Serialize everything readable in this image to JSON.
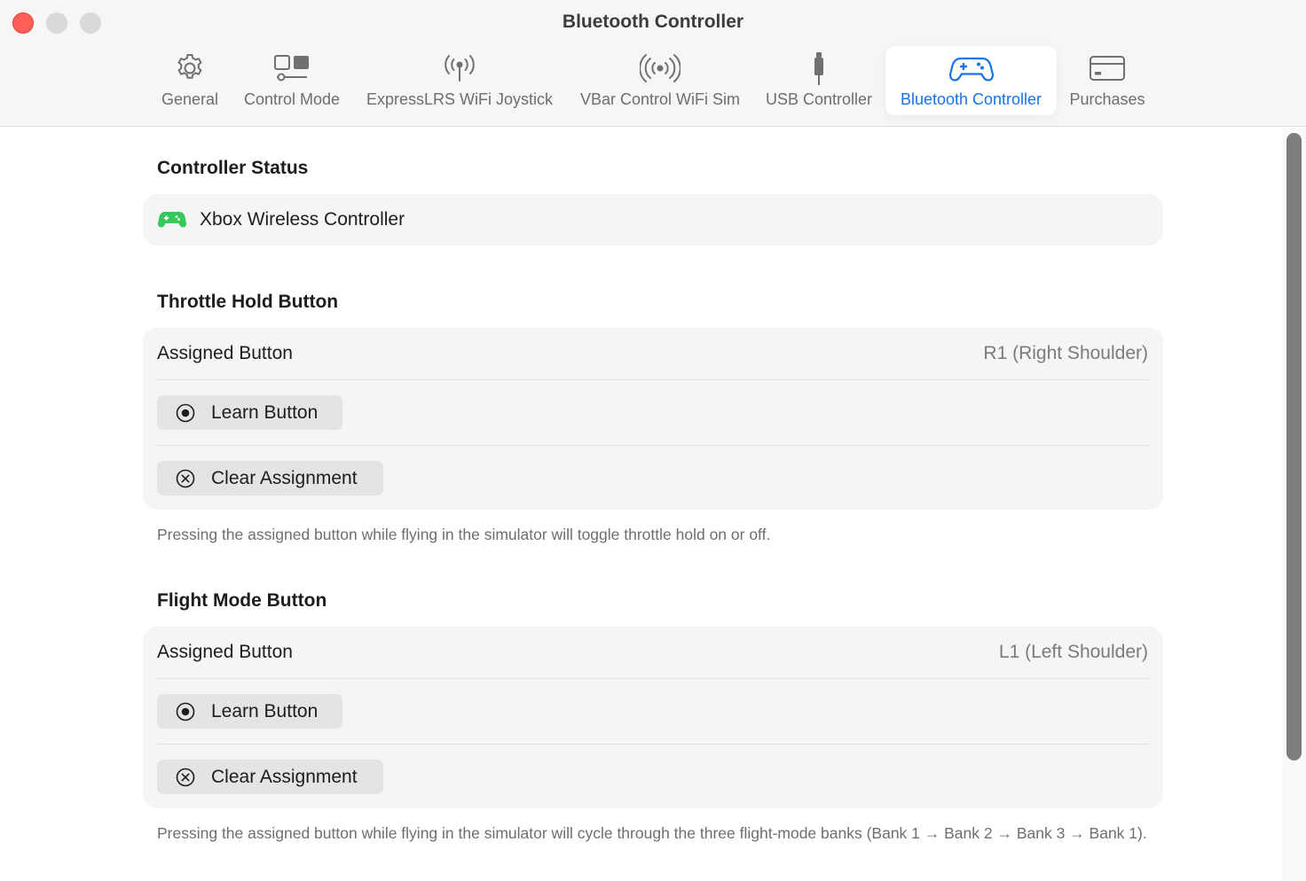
{
  "window": {
    "title": "Bluetooth Controller"
  },
  "tabs": [
    {
      "label": "General",
      "icon": "gear-icon"
    },
    {
      "label": "Control Mode",
      "icon": "control-mode-icon"
    },
    {
      "label": "ExpressLRS WiFi Joystick",
      "icon": "antenna-icon"
    },
    {
      "label": "VBar Control WiFi Sim",
      "icon": "broadcast-icon"
    },
    {
      "label": "USB Controller",
      "icon": "usb-cable-icon"
    },
    {
      "label": "Bluetooth Controller",
      "icon": "gamecontroller-icon",
      "active": true
    },
    {
      "label": "Purchases",
      "icon": "credit-card-icon"
    }
  ],
  "colors": {
    "accent": "#1a73e8",
    "connected": "#34c759",
    "close": "#fe5f57"
  },
  "controller_status": {
    "title": "Controller Status",
    "device_name": "Xbox Wireless Controller",
    "icon": "gamecontroller-icon"
  },
  "throttle_hold": {
    "title": "Throttle Hold Button",
    "assigned_label": "Assigned Button",
    "assigned_value": "R1 (Right Shoulder)",
    "learn_label": "Learn Button",
    "clear_label": "Clear Assignment",
    "footnote": "Pressing the assigned button while flying in the simulator will toggle throttle hold on or off."
  },
  "flight_mode": {
    "title": "Flight Mode Button",
    "assigned_label": "Assigned Button",
    "assigned_value": "L1 (Left Shoulder)",
    "learn_label": "Learn Button",
    "clear_label": "Clear Assignment",
    "footnote": "Pressing the assigned button while flying in the simulator will cycle through the three flight-mode banks (Bank 1 → Bank 2 → Bank 3 → Bank 1)."
  }
}
